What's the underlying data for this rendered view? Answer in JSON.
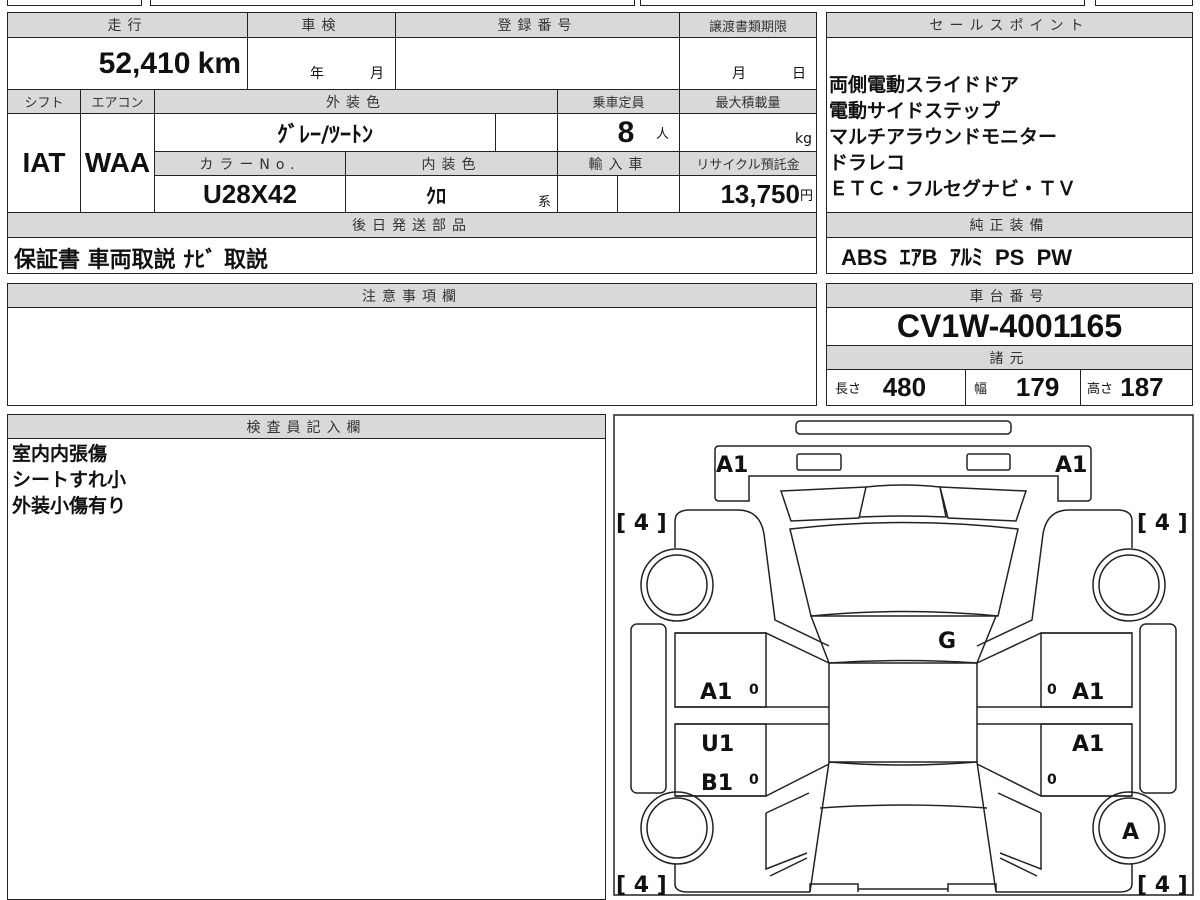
{
  "main": {
    "mileage": {
      "label": "走行",
      "value": "52,410",
      "unit": "km"
    },
    "inspection": {
      "label": "車検",
      "year_unit": "年",
      "month_unit": "月"
    },
    "registration": {
      "label": "登録番号"
    },
    "transfer_deadline": {
      "label": "譲渡書類期限",
      "month_unit": "月",
      "day_unit": "日"
    },
    "shift": {
      "label": "シフト",
      "value": "IAT"
    },
    "aircon": {
      "label": "エアコン",
      "value": "WAA"
    },
    "exterior_color": {
      "label": "外装色",
      "value": "ｸﾞﾚｰ/ﾂｰﾄﾝ"
    },
    "capacity": {
      "label": "乗車定員",
      "value": "8",
      "unit": "人"
    },
    "max_load": {
      "label": "最大積載量",
      "unit": "kg"
    },
    "color_no": {
      "label": "カラーNo.",
      "value": "U28X42"
    },
    "interior_color": {
      "label": "内装色",
      "value": "ｸﾛ",
      "suffix": "系"
    },
    "import": {
      "label": "輸入車"
    },
    "recycle_fee": {
      "label": "リサイクル預託金",
      "value": "13,750",
      "unit": "円"
    },
    "later_parts": {
      "label": "後日発送部品",
      "value": "保証書 車両取説 ﾅﾋﾞ 取説"
    }
  },
  "sales_points": {
    "label": "セールスポイント",
    "items": [
      "両側電動スライドドア",
      "電動サイドステップ",
      "マルチアラウンドモニター",
      "ドラレコ",
      "ＥＴＣ・フルセグナビ・ＴＶ"
    ]
  },
  "standard_equipment": {
    "label": "純正装備",
    "value": "ABS  ｴｱB  ｱﾙﾐ  PS  PW"
  },
  "notes": {
    "label": "注意事項欄"
  },
  "chassis": {
    "label": "車台番号",
    "value": "CV1W-4001165"
  },
  "specs": {
    "label": "諸元",
    "length": {
      "label": "長さ",
      "value": "480"
    },
    "width": {
      "label": "幅",
      "value": "179"
    },
    "height": {
      "label": "高さ",
      "value": "187"
    }
  },
  "inspector": {
    "label": "検査員記入欄",
    "lines": [
      "室内内張傷",
      "シートすれ小",
      "外装小傷有り"
    ]
  },
  "diagram": {
    "front_left": "A1",
    "front_right": "A1",
    "tire_fl": "[ 4 ]",
    "tire_fr": "[ 4 ]",
    "tire_rl": "[ 4 ]",
    "tire_rr": "[ 4 ]",
    "windshield": "G",
    "front_door_left": "A1",
    "front_door_left_mark": "0",
    "front_door_right": "A1",
    "front_door_right_mark": "0",
    "rear_door_left_1": "U1",
    "rear_door_left_2": "B1",
    "rear_door_left_mark": "0",
    "rear_door_right": "A1",
    "rear_door_right_mark": "0",
    "rear_right_wheel": "A"
  }
}
